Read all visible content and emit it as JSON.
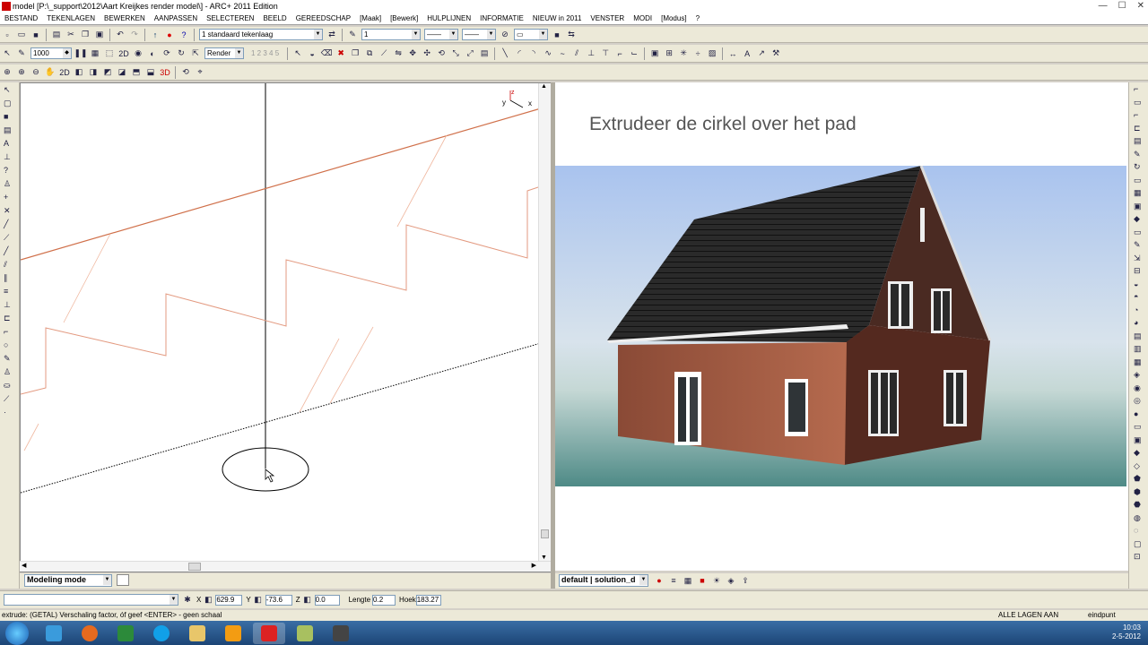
{
  "window": {
    "title": "model [P:\\_support\\2012\\Aart Kreijkes render model\\] - ARC+ 2011 Edition",
    "controls": [
      "—",
      "☐",
      "✕"
    ]
  },
  "menu": [
    "BESTAND",
    "TEKENLAGEN",
    "BEWERKEN",
    "AANPASSEN",
    "SELECTEREN",
    "BEELD",
    "GEREEDSCHAP",
    "[Maak]",
    "[Bewerk]",
    "HULPLIJNEN",
    "INFORMATIE",
    "NIEUW in 2011",
    "VENSTER",
    "MODI",
    "[Modus]",
    "?"
  ],
  "toolbar2": {
    "scale_value": "1000",
    "layer_value": "1 standaard tekenlaag",
    "pen_value": "1",
    "render_value": "Render",
    "layer_numbers": "1 2 3 4 5"
  },
  "left_view": {
    "ucs_y": "y",
    "ucs_z": "z",
    "ucs_x": "x",
    "mode_value": "Modeling mode"
  },
  "right_view": {
    "caption": "Extrudeer de cirkel over het pad",
    "solution_value": "default | solution_d"
  },
  "coords": {
    "x_label": "X",
    "x_value": "629.9",
    "y_label": "Y",
    "y_value": "-73.6",
    "z_label": "Z",
    "z_value": "0.0",
    "length_label": "Lengte",
    "length_value": "0.2",
    "angle_label": "Hoek",
    "angle_value": "183.27"
  },
  "command_line": "extrude: (GETAL) Verschaling factor, óf geef <ENTER> - geen schaal",
  "status": {
    "layers": "ALLE LAGEN AAN",
    "snap": "eindpunt"
  },
  "clock": {
    "time": "10:03",
    "date": "2-5-2012"
  },
  "colors": {
    "accent": "#3a6ea5",
    "path_line": "#e07a50"
  }
}
